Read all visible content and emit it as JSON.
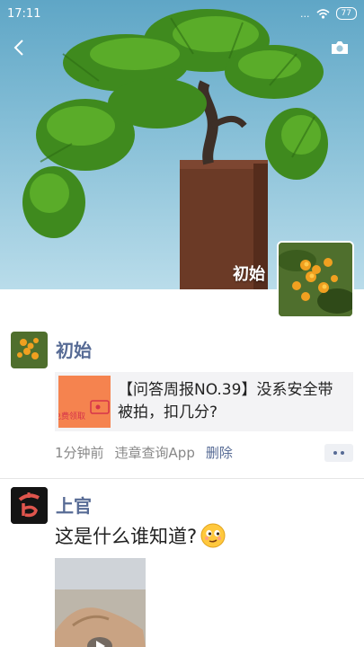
{
  "status_bar": {
    "time": "17:11",
    "signal": "...",
    "battery": "77"
  },
  "cover": {
    "owner_name": "初始"
  },
  "posts": [
    {
      "author": "初始",
      "shared_link": {
        "thumbnail_text": "免费领取",
        "title": "【问答周报NO.39】没系安全带被拍，扣几分?"
      },
      "time": "1分钟前",
      "source": "违章查询App",
      "delete_label": "删除"
    },
    {
      "author": "上官",
      "text": "这是什么谁知道?"
    }
  ],
  "colors": {
    "nickname": "#576b95",
    "link_bg": "#f3f3f5",
    "thumb_bg": "#f5834f"
  },
  "icons": [
    "back-icon",
    "camera-icon",
    "wifi-icon",
    "more-dots-icon",
    "smirk-emoji-icon",
    "play-icon"
  ]
}
